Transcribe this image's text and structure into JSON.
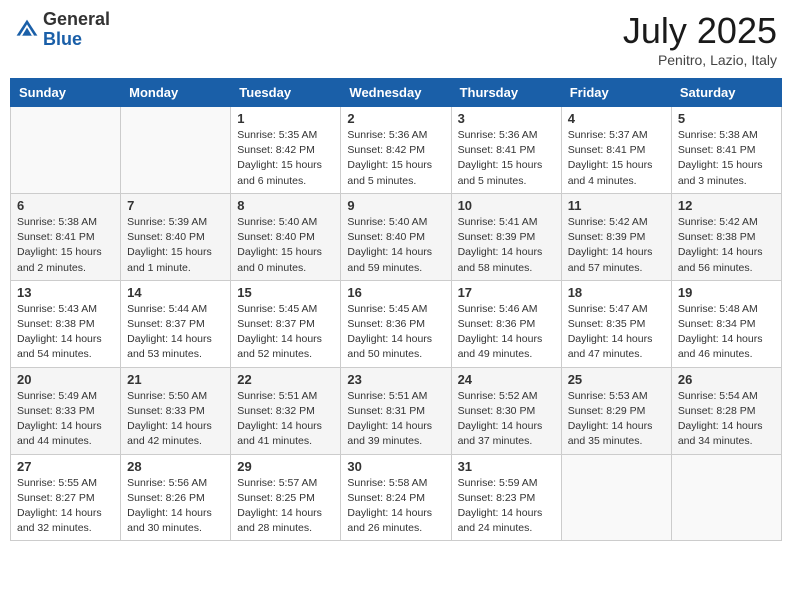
{
  "logo": {
    "general": "General",
    "blue": "Blue"
  },
  "header": {
    "month": "July 2025",
    "location": "Penitro, Lazio, Italy"
  },
  "weekdays": [
    "Sunday",
    "Monday",
    "Tuesday",
    "Wednesday",
    "Thursday",
    "Friday",
    "Saturday"
  ],
  "weeks": [
    [
      {
        "day": "",
        "sunrise": "",
        "sunset": "",
        "daylight": ""
      },
      {
        "day": "",
        "sunrise": "",
        "sunset": "",
        "daylight": ""
      },
      {
        "day": "1",
        "sunrise": "Sunrise: 5:35 AM",
        "sunset": "Sunset: 8:42 PM",
        "daylight": "Daylight: 15 hours and 6 minutes."
      },
      {
        "day": "2",
        "sunrise": "Sunrise: 5:36 AM",
        "sunset": "Sunset: 8:42 PM",
        "daylight": "Daylight: 15 hours and 5 minutes."
      },
      {
        "day": "3",
        "sunrise": "Sunrise: 5:36 AM",
        "sunset": "Sunset: 8:41 PM",
        "daylight": "Daylight: 15 hours and 5 minutes."
      },
      {
        "day": "4",
        "sunrise": "Sunrise: 5:37 AM",
        "sunset": "Sunset: 8:41 PM",
        "daylight": "Daylight: 15 hours and 4 minutes."
      },
      {
        "day": "5",
        "sunrise": "Sunrise: 5:38 AM",
        "sunset": "Sunset: 8:41 PM",
        "daylight": "Daylight: 15 hours and 3 minutes."
      }
    ],
    [
      {
        "day": "6",
        "sunrise": "Sunrise: 5:38 AM",
        "sunset": "Sunset: 8:41 PM",
        "daylight": "Daylight: 15 hours and 2 minutes."
      },
      {
        "day": "7",
        "sunrise": "Sunrise: 5:39 AM",
        "sunset": "Sunset: 8:40 PM",
        "daylight": "Daylight: 15 hours and 1 minute."
      },
      {
        "day": "8",
        "sunrise": "Sunrise: 5:40 AM",
        "sunset": "Sunset: 8:40 PM",
        "daylight": "Daylight: 15 hours and 0 minutes."
      },
      {
        "day": "9",
        "sunrise": "Sunrise: 5:40 AM",
        "sunset": "Sunset: 8:40 PM",
        "daylight": "Daylight: 14 hours and 59 minutes."
      },
      {
        "day": "10",
        "sunrise": "Sunrise: 5:41 AM",
        "sunset": "Sunset: 8:39 PM",
        "daylight": "Daylight: 14 hours and 58 minutes."
      },
      {
        "day": "11",
        "sunrise": "Sunrise: 5:42 AM",
        "sunset": "Sunset: 8:39 PM",
        "daylight": "Daylight: 14 hours and 57 minutes."
      },
      {
        "day": "12",
        "sunrise": "Sunrise: 5:42 AM",
        "sunset": "Sunset: 8:38 PM",
        "daylight": "Daylight: 14 hours and 56 minutes."
      }
    ],
    [
      {
        "day": "13",
        "sunrise": "Sunrise: 5:43 AM",
        "sunset": "Sunset: 8:38 PM",
        "daylight": "Daylight: 14 hours and 54 minutes."
      },
      {
        "day": "14",
        "sunrise": "Sunrise: 5:44 AM",
        "sunset": "Sunset: 8:37 PM",
        "daylight": "Daylight: 14 hours and 53 minutes."
      },
      {
        "day": "15",
        "sunrise": "Sunrise: 5:45 AM",
        "sunset": "Sunset: 8:37 PM",
        "daylight": "Daylight: 14 hours and 52 minutes."
      },
      {
        "day": "16",
        "sunrise": "Sunrise: 5:45 AM",
        "sunset": "Sunset: 8:36 PM",
        "daylight": "Daylight: 14 hours and 50 minutes."
      },
      {
        "day": "17",
        "sunrise": "Sunrise: 5:46 AM",
        "sunset": "Sunset: 8:36 PM",
        "daylight": "Daylight: 14 hours and 49 minutes."
      },
      {
        "day": "18",
        "sunrise": "Sunrise: 5:47 AM",
        "sunset": "Sunset: 8:35 PM",
        "daylight": "Daylight: 14 hours and 47 minutes."
      },
      {
        "day": "19",
        "sunrise": "Sunrise: 5:48 AM",
        "sunset": "Sunset: 8:34 PM",
        "daylight": "Daylight: 14 hours and 46 minutes."
      }
    ],
    [
      {
        "day": "20",
        "sunrise": "Sunrise: 5:49 AM",
        "sunset": "Sunset: 8:33 PM",
        "daylight": "Daylight: 14 hours and 44 minutes."
      },
      {
        "day": "21",
        "sunrise": "Sunrise: 5:50 AM",
        "sunset": "Sunset: 8:33 PM",
        "daylight": "Daylight: 14 hours and 42 minutes."
      },
      {
        "day": "22",
        "sunrise": "Sunrise: 5:51 AM",
        "sunset": "Sunset: 8:32 PM",
        "daylight": "Daylight: 14 hours and 41 minutes."
      },
      {
        "day": "23",
        "sunrise": "Sunrise: 5:51 AM",
        "sunset": "Sunset: 8:31 PM",
        "daylight": "Daylight: 14 hours and 39 minutes."
      },
      {
        "day": "24",
        "sunrise": "Sunrise: 5:52 AM",
        "sunset": "Sunset: 8:30 PM",
        "daylight": "Daylight: 14 hours and 37 minutes."
      },
      {
        "day": "25",
        "sunrise": "Sunrise: 5:53 AM",
        "sunset": "Sunset: 8:29 PM",
        "daylight": "Daylight: 14 hours and 35 minutes."
      },
      {
        "day": "26",
        "sunrise": "Sunrise: 5:54 AM",
        "sunset": "Sunset: 8:28 PM",
        "daylight": "Daylight: 14 hours and 34 minutes."
      }
    ],
    [
      {
        "day": "27",
        "sunrise": "Sunrise: 5:55 AM",
        "sunset": "Sunset: 8:27 PM",
        "daylight": "Daylight: 14 hours and 32 minutes."
      },
      {
        "day": "28",
        "sunrise": "Sunrise: 5:56 AM",
        "sunset": "Sunset: 8:26 PM",
        "daylight": "Daylight: 14 hours and 30 minutes."
      },
      {
        "day": "29",
        "sunrise": "Sunrise: 5:57 AM",
        "sunset": "Sunset: 8:25 PM",
        "daylight": "Daylight: 14 hours and 28 minutes."
      },
      {
        "day": "30",
        "sunrise": "Sunrise: 5:58 AM",
        "sunset": "Sunset: 8:24 PM",
        "daylight": "Daylight: 14 hours and 26 minutes."
      },
      {
        "day": "31",
        "sunrise": "Sunrise: 5:59 AM",
        "sunset": "Sunset: 8:23 PM",
        "daylight": "Daylight: 14 hours and 24 minutes."
      },
      {
        "day": "",
        "sunrise": "",
        "sunset": "",
        "daylight": ""
      },
      {
        "day": "",
        "sunrise": "",
        "sunset": "",
        "daylight": ""
      }
    ]
  ]
}
